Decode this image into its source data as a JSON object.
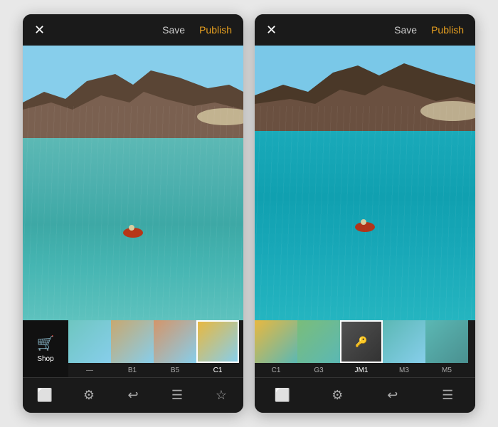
{
  "left_phone": {
    "close_label": "✕",
    "save_label": "Save",
    "publish_label": "Publish",
    "shop_label": "Shop",
    "filters": [
      {
        "id": "none",
        "label": "—",
        "active": false,
        "colorClass": "ft-none"
      },
      {
        "id": "b1",
        "label": "B1",
        "active": false,
        "colorClass": "ft-b1"
      },
      {
        "id": "b5",
        "label": "B5",
        "active": false,
        "colorClass": "ft-b5"
      },
      {
        "id": "c1",
        "label": "C1",
        "active": true,
        "colorClass": "ft-c1"
      }
    ],
    "toolbar": [
      {
        "icon": "⬜",
        "name": "crop",
        "active": true
      },
      {
        "icon": "⚙",
        "name": "adjust",
        "active": false
      },
      {
        "icon": "↩",
        "name": "revert",
        "active": false
      },
      {
        "icon": "☰",
        "name": "menu",
        "active": false
      },
      {
        "icon": "★",
        "name": "favorite",
        "active": false
      }
    ]
  },
  "right_phone": {
    "close_label": "✕",
    "save_label": "Save",
    "publish_label": "Publish",
    "filters": [
      {
        "id": "c1",
        "label": "C1",
        "active": false,
        "colorClass": "ft-c1r"
      },
      {
        "id": "g3",
        "label": "G3",
        "active": false,
        "colorClass": "ft-g3"
      },
      {
        "id": "jm1",
        "label": "JM1",
        "active": true,
        "colorClass": "ft-jm1",
        "locked": true
      },
      {
        "id": "m3",
        "label": "M3",
        "active": false,
        "colorClass": "ft-m3"
      },
      {
        "id": "m5",
        "label": "M5",
        "active": false,
        "colorClass": "ft-m5"
      }
    ],
    "toolbar": [
      {
        "icon": "⬜",
        "name": "crop",
        "active": true
      },
      {
        "icon": "⚙",
        "name": "adjust",
        "active": false
      },
      {
        "icon": "↩",
        "name": "revert",
        "active": false
      },
      {
        "icon": "☰",
        "name": "menu",
        "active": false
      }
    ]
  }
}
